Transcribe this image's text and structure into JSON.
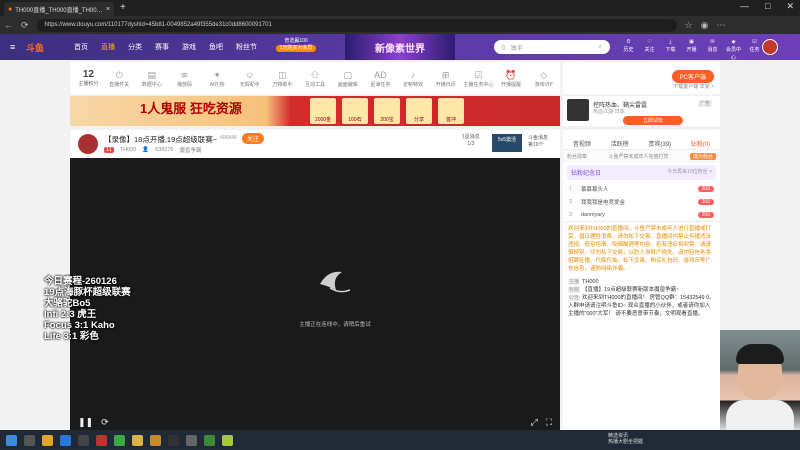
{
  "browser": {
    "tab_title": "TH000直播_TH000直播_TH000哔",
    "new_tab": "+",
    "url": "https://www.douyu.com/110177dyshid=45b81-0049852a49f355de31c0dd8600091701",
    "win_controls": [
      "—",
      "□",
      "✕"
    ]
  },
  "header": {
    "logo": "斗鱼",
    "nav": [
      "首页",
      "直播",
      "分类",
      "赛事",
      "游戏",
      "鱼吧",
      "粉丝节"
    ],
    "active_nav": "直播",
    "promo_line1": "普选赢100",
    "promo_line2": "1元购买大会员",
    "banner": "新像素世界",
    "search_placeholder": "0 · 独伞",
    "icons": [
      "历史",
      "关注",
      "下载",
      "开播",
      "消息",
      "会员中心",
      "任务"
    ]
  },
  "toolbar": {
    "level": "12",
    "level_label": "主播积分",
    "tools": [
      "直播开关",
      "数据中心",
      "播放码",
      "AI礼物",
      "无瑕助手",
      "万物助手",
      "互动工具",
      "画面编辑",
      "星海任务",
      "定制特效",
      "开播日历",
      "主播任务中心",
      "开播提醒",
      "游戏VIP",
      "更多"
    ]
  },
  "pc_gift": {
    "button": "PC客户端",
    "sub": "下载客户端 享受 >"
  },
  "ad": {
    "slogan": "1人鬼服 狂吃资源",
    "items": [
      "2000金",
      "100石",
      "200宝",
      "分享",
      "首冲"
    ]
  },
  "shop": {
    "title": "控阵热血、鞘尖雷霆",
    "sub": "热血江湖·日本",
    "tag": "广告",
    "buy": "立即试玩"
  },
  "room": {
    "title": "【录像】18点开播,19点超级联赛~",
    "streamer": "TH000",
    "level": "11",
    "followers": "538376",
    "category": "魔兽争霸",
    "id": "406848",
    "follow": "关注",
    "rank_label": "1星消息",
    "rank_value": "1/3",
    "pk": "5v5激活",
    "hot": "斗鱼消息",
    "hot2": "第10个"
  },
  "video": {
    "loading_msg": "主播正在连线中，请稍后重试",
    "controls": {
      "pause": "❚❚",
      "refresh": "⟳",
      "fullscreen_web": "⤢",
      "fullscreen": "⛶"
    }
  },
  "overlay": {
    "lines": [
      "今日赛程-260126",
      "19点海豚杯超级联赛",
      "大骆驼Bo5",
      "Infi  2:3 虎王",
      "Focus 3:1 Kaho",
      "Life   3:1 彩色"
    ]
  },
  "chat": {
    "tabs": [
      "音视频",
      "活跃榜",
      "贵宾(39)",
      "钻粉(0)"
    ],
    "active_tab": "钻粉(0)",
    "fans_hint": "粉丝勋章",
    "fans_hint_right": "斗鱼严禁未成年人充值打赏",
    "fans_btn": "成为粉丝",
    "fans_title": "钻粉纪念日",
    "fans_small": "今日再来10位粉丝 >",
    "ranking": [
      {
        "n": "1",
        "name": "慕慕慕头人",
        "score": "300"
      },
      {
        "n": "2",
        "name": "我我我是电竞爱金",
        "score": "300"
      },
      {
        "n": "3",
        "name": "danniyary",
        "score": "300"
      }
    ],
    "notice": "欢迎来到TH000的直播间。斗鱼严禁未成年人进行直播或打赏。倡议理性消费，请勿私下交易。直播间内禁止传播违法违规、低俗色情、吸烟酗酒等内容，若有违反将封禁。请谨慎辨别，切勿私下交易，以防人身财产损失。请勿轻信各类招聘征婚、代练代抽、私下交易、购买礼包码、游戏币等广告信息，谨防网络诈骗。",
    "messages": [
      {
        "label": "主播",
        "text": "TH000"
      },
      {
        "label": "标题",
        "text": "【直播】19点超级联赛新版本魔兽争霸~"
      },
      {
        "label": "公告",
        "text": "欢迎来到TH000的直播间！ 房管QQ群：15432549 0。入群申请请注明斗鱼ID~ 观众直播的小伙伴，或者请你加入主播的“000”大军！ 请不要恶意带节奏，文明观看直播。"
      }
    ]
  },
  "taskbar": {
    "notif1": "精选资讯",
    "notif2": "热播大剧全把握"
  },
  "colors": {
    "accent": "#ff5d23",
    "header": "#5a3aa6"
  }
}
